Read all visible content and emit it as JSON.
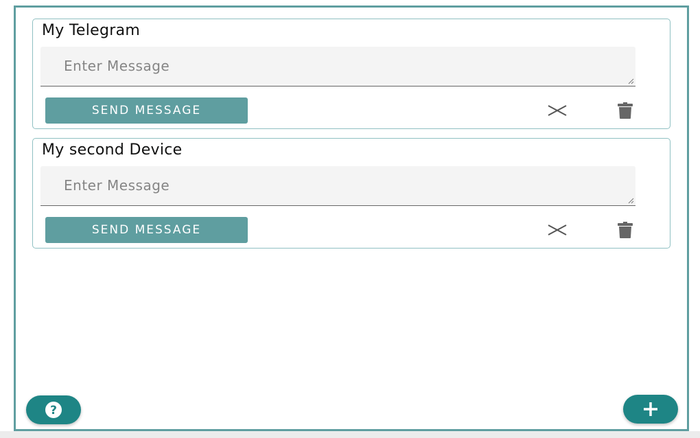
{
  "devices": [
    {
      "title": "My Telegram",
      "message_placeholder": "Enter Message",
      "send_label": "SEND MESSAGE",
      "close_icon": "close-icon",
      "delete_icon": "trash-icon"
    },
    {
      "title": "My second Device",
      "message_placeholder": "Enter Message",
      "send_label": "SEND MESSAGE",
      "close_icon": "close-icon",
      "delete_icon": "trash-icon"
    }
  ],
  "fabs": {
    "help_icon": "question-circle-icon",
    "add_icon": "plus-icon"
  },
  "colors": {
    "accent": "#5f9ea0",
    "fab": "#1e8585",
    "input_bg": "#f4f4f4"
  }
}
